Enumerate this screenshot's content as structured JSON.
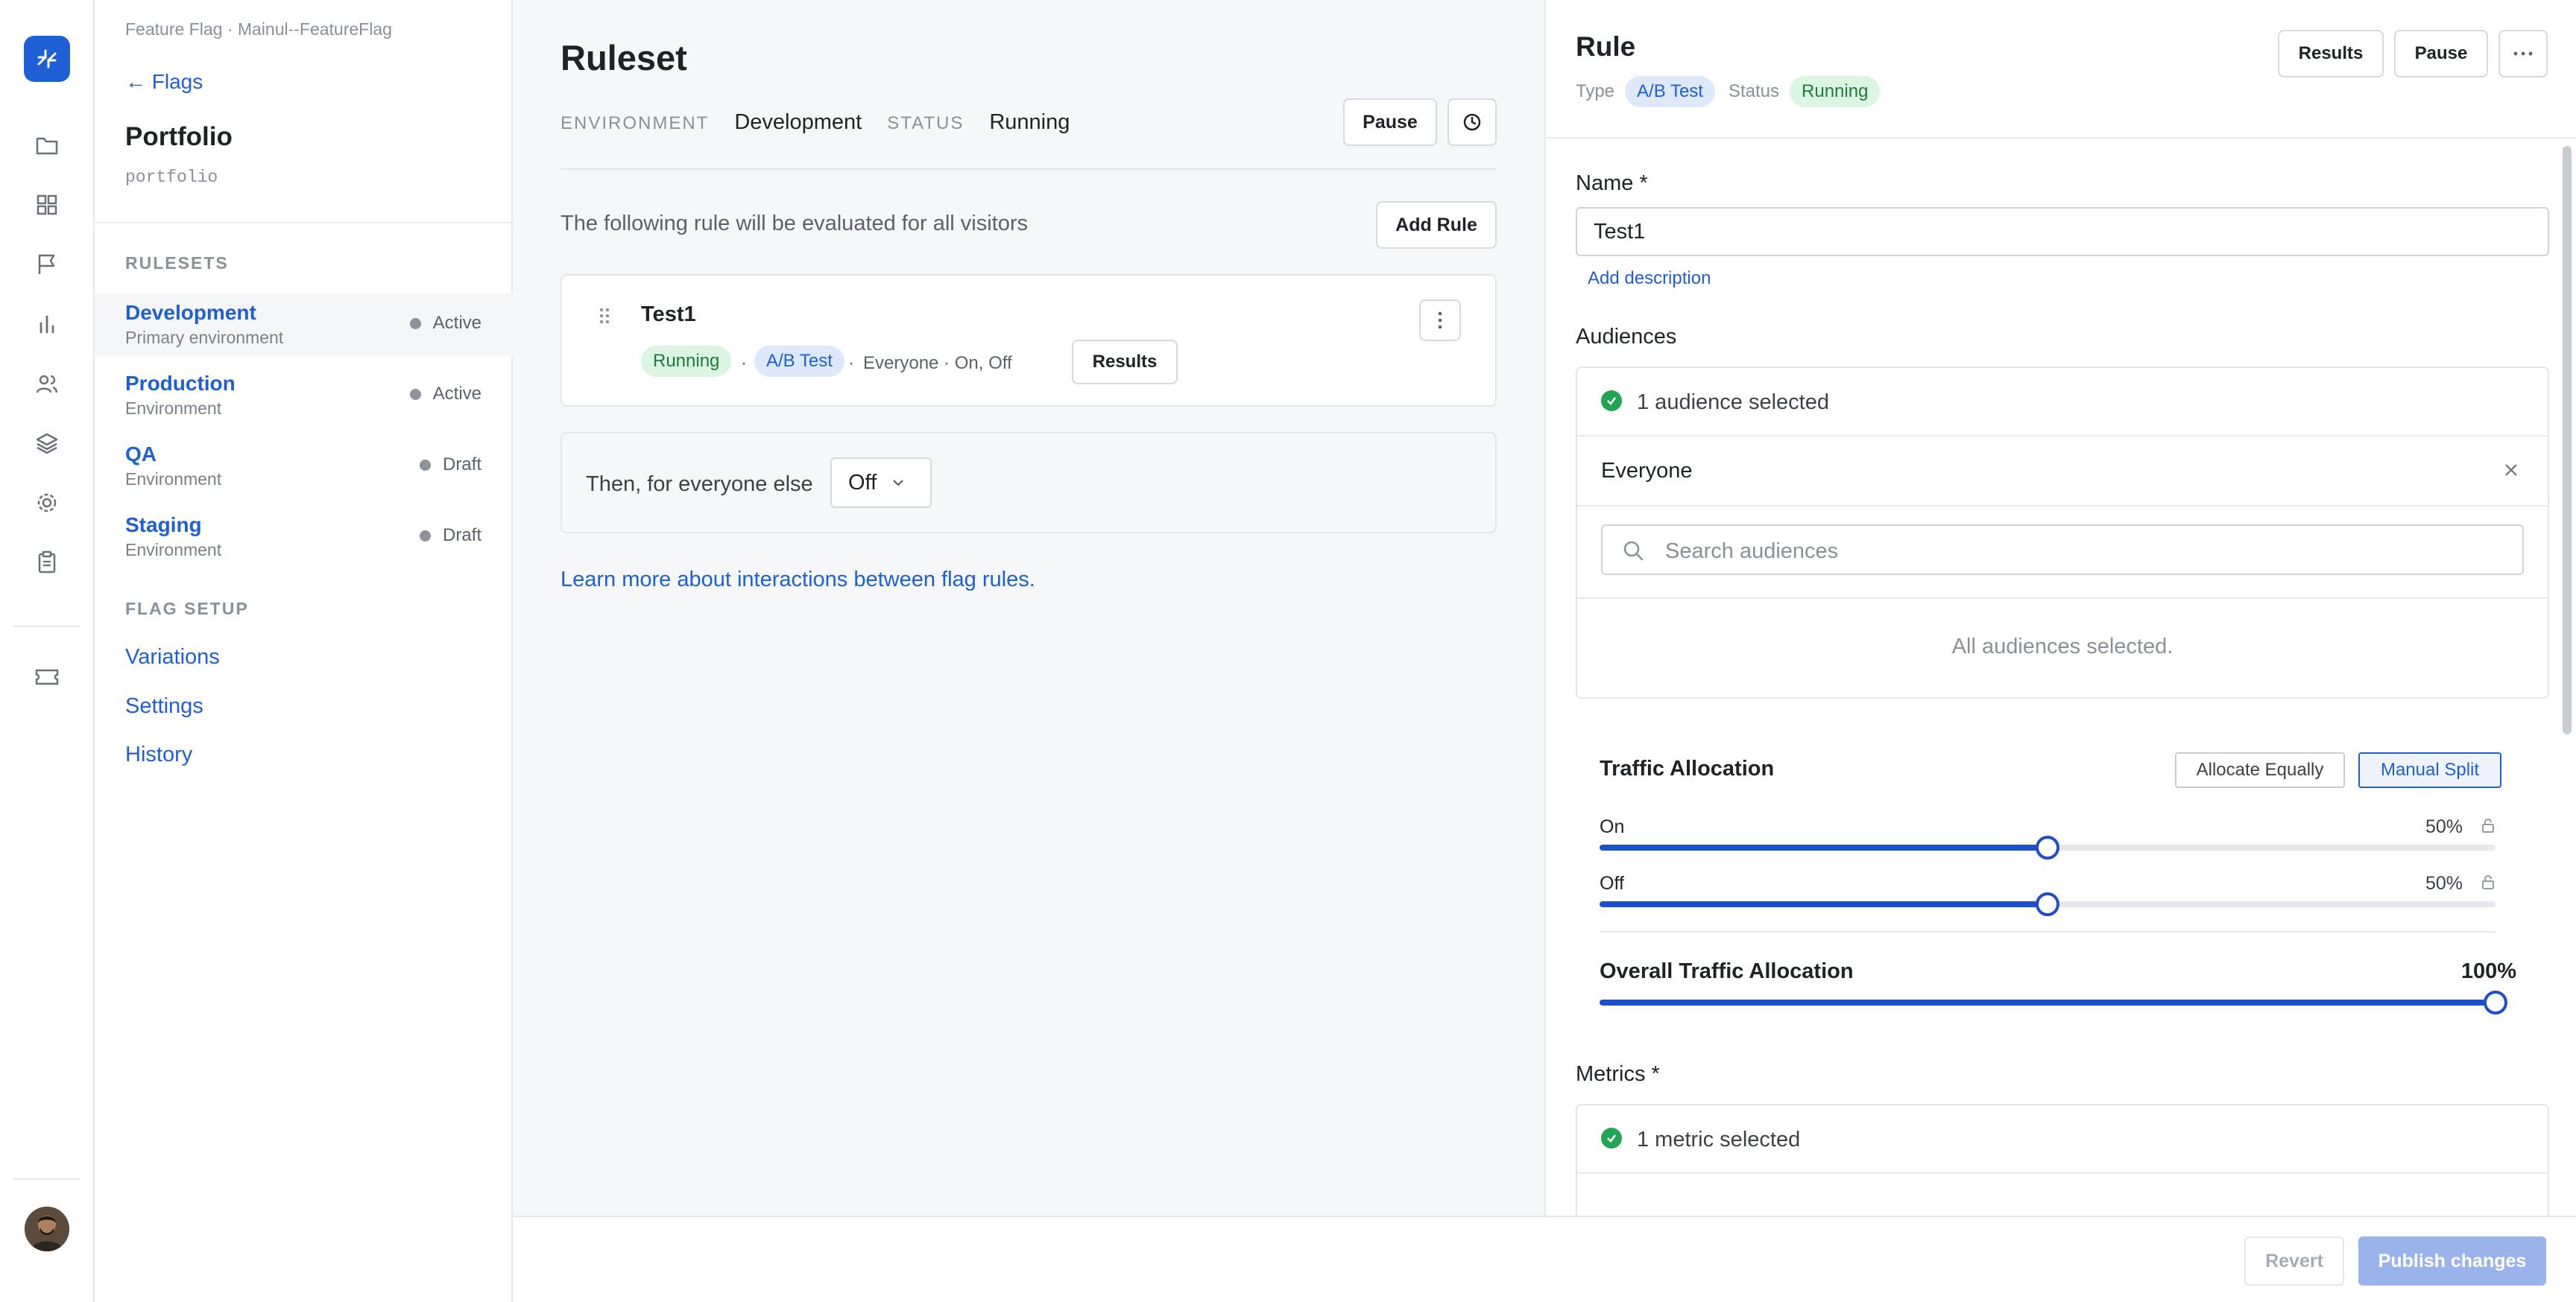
{
  "breadcrumb": "Feature Flag · Mainul--FeatureFlag",
  "back_link": "← Flags",
  "project": {
    "title": "Portfolio",
    "key": "portfolio"
  },
  "rulesets": {
    "heading": "RULESETS",
    "items": [
      {
        "name": "Development",
        "subtitle": "Primary environment",
        "status": "Active"
      },
      {
        "name": "Production",
        "subtitle": "Environment",
        "status": "Active"
      },
      {
        "name": "QA",
        "subtitle": "Environment",
        "status": "Draft"
      },
      {
        "name": "Staging",
        "subtitle": "Environment",
        "status": "Draft"
      }
    ]
  },
  "flag_setup": {
    "heading": "FLAG SETUP",
    "links": [
      "Variations",
      "Settings",
      "History"
    ]
  },
  "ruleset": {
    "title": "Ruleset",
    "environment_label": "ENVIRONMENT",
    "environment_value": "Development",
    "status_label": "STATUS",
    "status_value": "Running",
    "pause_label": "Pause",
    "description": "The following rule will be evaluated for all visitors",
    "add_rule_label": "Add Rule",
    "rule": {
      "name": "Test1",
      "status_pill": "Running",
      "type_pill": "A/B Test",
      "separator": "·",
      "audience_text": "Everyone · On, Off",
      "results_label": "Results"
    },
    "else_text": "Then, for everyone else",
    "else_value": "Off",
    "learn_link": "Learn more about interactions between flag rules."
  },
  "rule_panel": {
    "title": "Rule",
    "type_label": "Type",
    "type_value": "A/B Test",
    "status_label": "Status",
    "status_value": "Running",
    "results_label": "Results",
    "pause_label": "Pause",
    "name_label": "Name *",
    "name_value": "Test1",
    "add_description": "Add description",
    "audiences_label": "Audiences",
    "audiences_selected": "1 audience selected",
    "audience_item": "Everyone",
    "search_placeholder": "Search audiences",
    "all_selected": "All audiences selected.",
    "traffic": {
      "title": "Traffic Allocation",
      "allocate_equally": "Allocate Equally",
      "manual_split": "Manual Split",
      "variations": [
        {
          "label": "On",
          "percent": "50%",
          "value": 0.5
        },
        {
          "label": "Off",
          "percent": "50%",
          "value": 0.5
        }
      ],
      "overall_title": "Overall Traffic Allocation",
      "overall_percent": "100%",
      "overall_value": 1.0
    },
    "metrics_label": "Metrics *",
    "metrics_selected": "1 metric selected"
  },
  "footer": {
    "revert_label": "Revert",
    "publish_label": "Publish changes"
  },
  "colors": {
    "accent": "#1f5fd6",
    "success": "#22a454",
    "publish_disabled": "#9ab3ea"
  }
}
